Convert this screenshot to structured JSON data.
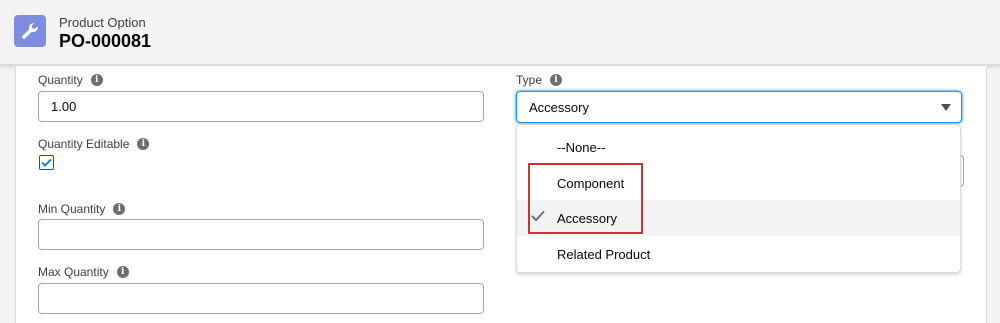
{
  "header": {
    "object_label": "Product Option",
    "record_name": "PO-000081",
    "icon": "wrench-icon",
    "icon_color": "#7f8de1"
  },
  "fields": {
    "quantity": {
      "label": "Quantity",
      "value": "1.00"
    },
    "quantity_editable": {
      "label": "Quantity Editable",
      "checked": true
    },
    "min_quantity": {
      "label": "Min Quantity",
      "value": ""
    },
    "max_quantity": {
      "label": "Max Quantity",
      "value": ""
    },
    "type": {
      "label": "Type",
      "value": "Accessory"
    }
  },
  "type_dropdown": {
    "options": [
      "--None--",
      "Component",
      "Accessory",
      "Related Product"
    ],
    "selected": "Accessory"
  },
  "colors": {
    "focus_border": "#1b96ff",
    "highlight_box": "#c23934",
    "checkbox_blue": "#0176d3"
  }
}
